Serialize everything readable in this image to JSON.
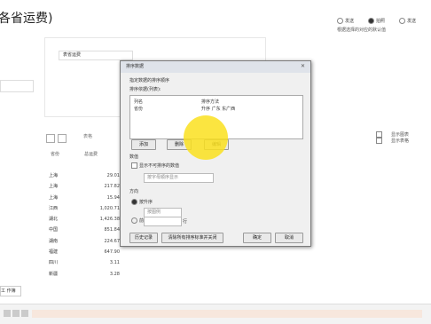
{
  "page_title": "各省运费)",
  "options_panel": {
    "radio_a": "发送",
    "radio_b": "拍照",
    "radio_c": "发送",
    "hint": "根据选择的对应的默认值"
  },
  "filter_input": "表省运费",
  "view_tab": "表格",
  "right_options": [
    "显示图表",
    "显示表格"
  ],
  "columns": [
    "省份",
    "总运费"
  ],
  "rows": [
    {
      "name": "上海",
      "value": "29.01"
    },
    {
      "name": "上海",
      "value": "217.82"
    },
    {
      "name": "上海",
      "value": "15.94"
    },
    {
      "name": "江西",
      "value": "1,020.71"
    },
    {
      "name": "湖北",
      "value": "1,426.38"
    },
    {
      "name": "中国",
      "value": "851.84"
    },
    {
      "name": "湖南",
      "value": "224.67"
    },
    {
      "name": "福建",
      "value": "647.90"
    },
    {
      "name": "四川",
      "value": "3.11"
    },
    {
      "name": "新疆",
      "value": "3.28"
    }
  ],
  "bottom_field": "工 作簿",
  "dialog": {
    "title": "排序数据",
    "section_label": "指定数据的排序顺序",
    "sort_by_label": "排序依据(列表):",
    "col1_header": "列名",
    "col2_header": "排序方法",
    "row_col1": "省份",
    "row_col2": "升序 广东 东广西",
    "btn_add": "添加",
    "btn_delete": "删除",
    "btn_edit": "编辑",
    "opt_section": "数值",
    "opt_checkbox": "显示不可排序的数值",
    "opt_combo": "按字母顺序显示",
    "direction_label": "方向",
    "radio_asc": "按升序",
    "radio_asc_combo": "按图例",
    "radio_custom": "前",
    "radio_custom_suffix": "行",
    "btn_history": "历史记录",
    "btn_clear": "清除所有排序标准并关闭",
    "btn_ok": "确定",
    "btn_cancel": "取消"
  }
}
